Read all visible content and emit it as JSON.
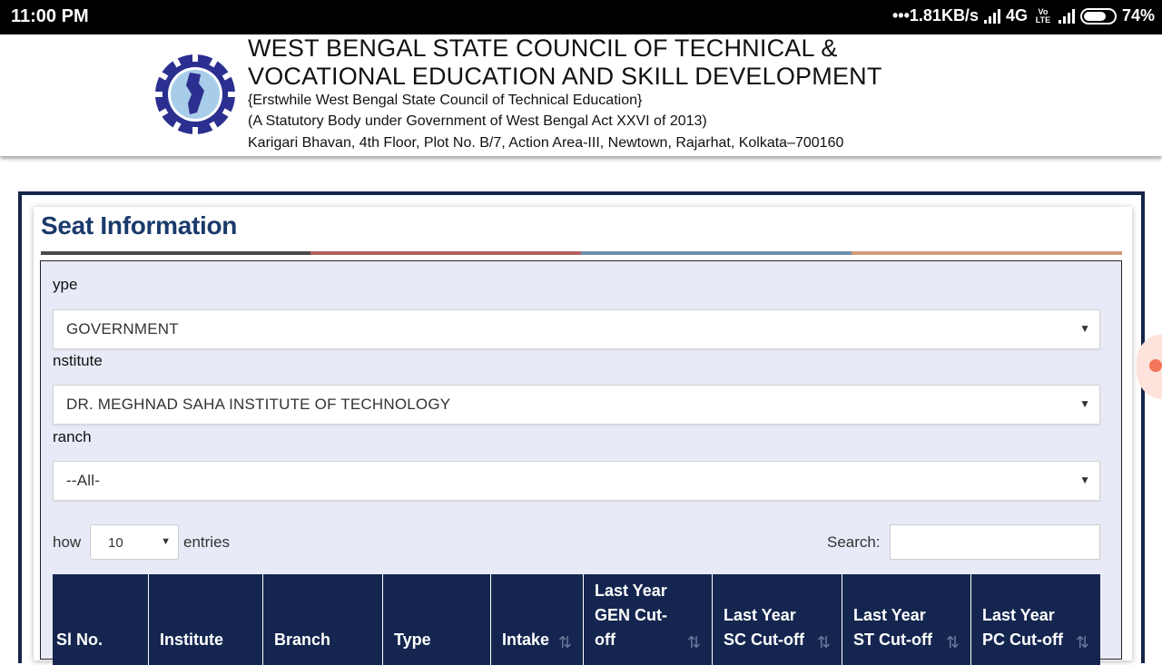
{
  "statusbar": {
    "time": "11:00 PM",
    "speed": "•••1.81KB/s",
    "network": "4G",
    "volte": "Vo LTE",
    "battery": "74%",
    "battery_level": 0.74
  },
  "header": {
    "title_line1": "WEST BENGAL STATE COUNCIL OF TECHNICAL &",
    "title_line2": "VOCATIONAL EDUCATION AND SKILL DEVELOPMENT",
    "sub1": "{Erstwhile West Bengal State Council of Technical Education}",
    "sub2": "(A Statutory Body under Government of West Bengal Act XXVI of 2013)",
    "sub3": "Karigari Bhavan, 4th Floor, Plot No. B/7, Action Area-III, Newtown, Rajarhat, Kolkata–700160",
    "logo_icon": "council-seal-icon"
  },
  "card": {
    "title": "Seat Information",
    "stripe_colors": [
      "#4a4a4a",
      "#b0615f",
      "#6f8fa8",
      "#d39a7a"
    ]
  },
  "form": {
    "type_label": "ype",
    "type_value": "GOVERNMENT",
    "institute_label": "nstitute",
    "institute_value": "DR. MEGHNAD SAHA INSTITUTE OF TECHNOLOGY",
    "branch_label": "ranch",
    "branch_value": "--All-"
  },
  "table_controls": {
    "show_label": "how",
    "entries_value": "10",
    "entries_label": "entries",
    "search_label": "Search:"
  },
  "table": {
    "columns": [
      {
        "line1": "",
        "line2": "",
        "line3": "Sl No.",
        "sortable": false
      },
      {
        "line1": "",
        "line2": "",
        "line3": "Institute",
        "sortable": false
      },
      {
        "line1": "",
        "line2": "",
        "line3": "Branch",
        "sortable": false
      },
      {
        "line1": "",
        "line2": "",
        "line3": "Type",
        "sortable": false
      },
      {
        "line1": "",
        "line2": "",
        "line3": "Intake",
        "sortable": true
      },
      {
        "line1": "Last Year",
        "line2": "GEN Cut-",
        "line3": "off",
        "sortable": true
      },
      {
        "line1": "",
        "line2": "Last Year",
        "line3": "SC Cut-off",
        "sortable": true
      },
      {
        "line1": "",
        "line2": "Last Year",
        "line3": "ST Cut-off",
        "sortable": true
      },
      {
        "line1": "",
        "line2": "Last Year",
        "line3": "PC Cut-off",
        "sortable": true
      }
    ],
    "sort_icon": "sort-arrows-icon"
  }
}
